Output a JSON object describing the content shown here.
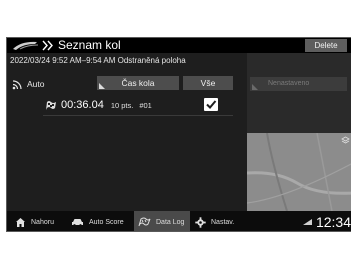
{
  "header": {
    "logo_alt": "Honda Sport",
    "title": "Seznam kol",
    "delete_label": "Delete"
  },
  "session": {
    "datetime_location": "2022/03/24 9:52 AM–9:54 AM Odstraněná poloha"
  },
  "controls": {
    "auto_label": "Auto",
    "lap_time_button": "Čas kola",
    "all_button": "Vše"
  },
  "records": [
    {
      "time": "00:36.04",
      "points": "10 pts.",
      "number": "#01",
      "checked": true
    }
  ],
  "right_panel": {
    "not_set_label": "Nenastaveno"
  },
  "bottom_nav": {
    "tabs": [
      {
        "label": "Nahoru",
        "icon": "home-icon"
      },
      {
        "label": "Auto Score",
        "icon": "car-icon"
      },
      {
        "label": "Data Log",
        "icon": "flag-icon",
        "active": true
      },
      {
        "label": "Nastav.",
        "icon": "gear-icon"
      }
    ]
  },
  "status": {
    "clock": "12:34"
  },
  "colors": {
    "background": "#1a1a1a",
    "button": "#4d4d4d",
    "active_tab": "#4a4a4a",
    "text": "#ffffff"
  }
}
